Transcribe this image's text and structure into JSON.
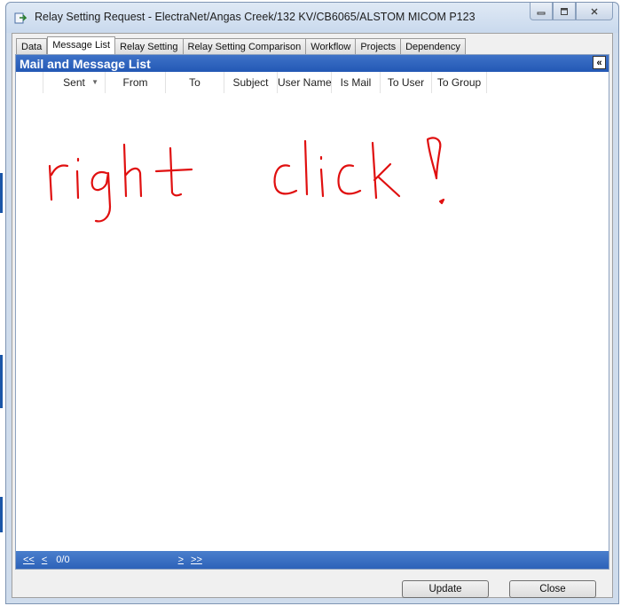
{
  "window": {
    "title": "Relay Setting Request - ElectraNet/Angas Creek/132 KV/CB6065/ALSTOM MICOM P123",
    "controls": [
      "minimize-icon",
      "maximize-icon",
      "close-icon"
    ]
  },
  "tabs": [
    {
      "label": "Data"
    },
    {
      "label": "Message List",
      "active": true
    },
    {
      "label": "Relay Setting"
    },
    {
      "label": "Relay Setting Comparison"
    },
    {
      "label": "Workflow"
    },
    {
      "label": "Projects"
    },
    {
      "label": "Dependency"
    }
  ],
  "panel": {
    "title": "Mail and Message List",
    "collapse_icon": "double-chevron-left-icon"
  },
  "grid": {
    "columns": [
      "Sent",
      "From",
      "To",
      "Subject",
      "User Name",
      "Is Mail",
      "To User",
      "To Group"
    ],
    "rows": []
  },
  "annotation": {
    "text": "right click !",
    "color": "#e01010"
  },
  "pager": {
    "first": "<<",
    "prev": "<",
    "count": "0/0",
    "next": ">",
    "last": ">>"
  },
  "buttons": {
    "update": "Update",
    "close": "Close"
  },
  "colors": {
    "panel_header": "#2f63bc",
    "pager": "#3a6fc2"
  }
}
